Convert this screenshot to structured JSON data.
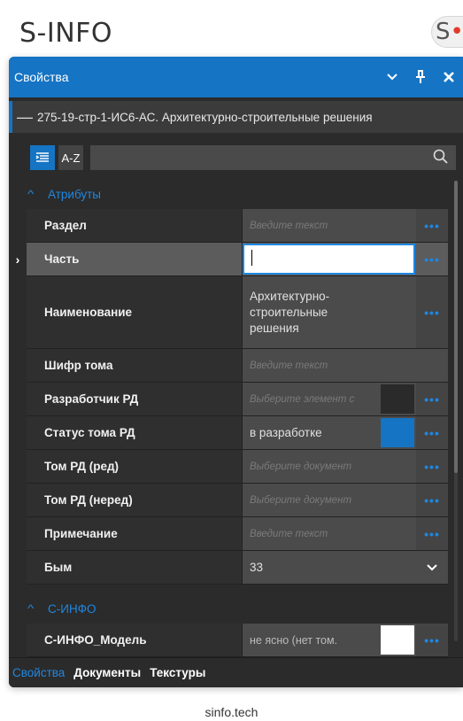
{
  "brand": {
    "title": "S-INFO",
    "logo_letter": "S",
    "logo_dot": "•"
  },
  "panel": {
    "title": "Свойства",
    "buttons": {
      "dropdown": "⌄",
      "pin": "📌",
      "close": "✕"
    },
    "document": "275-19-стр-1-ИС6-АС. Архитектурно-строительные решения",
    "toolbar": {
      "az_label": "A-Z",
      "search_value": ""
    },
    "groups": [
      {
        "title": "Атрибуты"
      },
      {
        "title": "С-ИНФО"
      }
    ],
    "rows": [
      {
        "label": "Раздел",
        "placeholder": "Введите текст",
        "value": ""
      },
      {
        "label": "Часть",
        "placeholder": "",
        "value": ""
      },
      {
        "label": "Наименование",
        "placeholder": "",
        "value": "Архитектурно-строительные решения"
      },
      {
        "label": "Шифр тома",
        "placeholder": "Введите текст",
        "value": ""
      },
      {
        "label": "Разработчик РД",
        "placeholder": "Выберите элемент с",
        "value": ""
      },
      {
        "label": "Статус тома РД",
        "placeholder": "",
        "value": "в разработке"
      },
      {
        "label": "Том РД (ред)",
        "placeholder": "Выберите документ",
        "value": ""
      },
      {
        "label": "Том РД (неред)",
        "placeholder": "Выберите документ",
        "value": ""
      },
      {
        "label": "Примечание",
        "placeholder": "Введите текст",
        "value": ""
      },
      {
        "label": "Бым",
        "placeholder": "",
        "value": "33"
      },
      {
        "label": "С-ИНФО_Модель",
        "placeholder": "",
        "value": "не ясно (нет том."
      }
    ],
    "colors": {
      "accent": "#1574c4",
      "status_swatch": "#1574c4",
      "dev_swatch": "#2a2a2a",
      "model_swatch": "#ffffff"
    },
    "selected_row_marker": "›",
    "tabs": [
      "Свойства",
      "Документы",
      "Текстуры"
    ]
  },
  "footer": {
    "text": "sinfo.tech"
  }
}
